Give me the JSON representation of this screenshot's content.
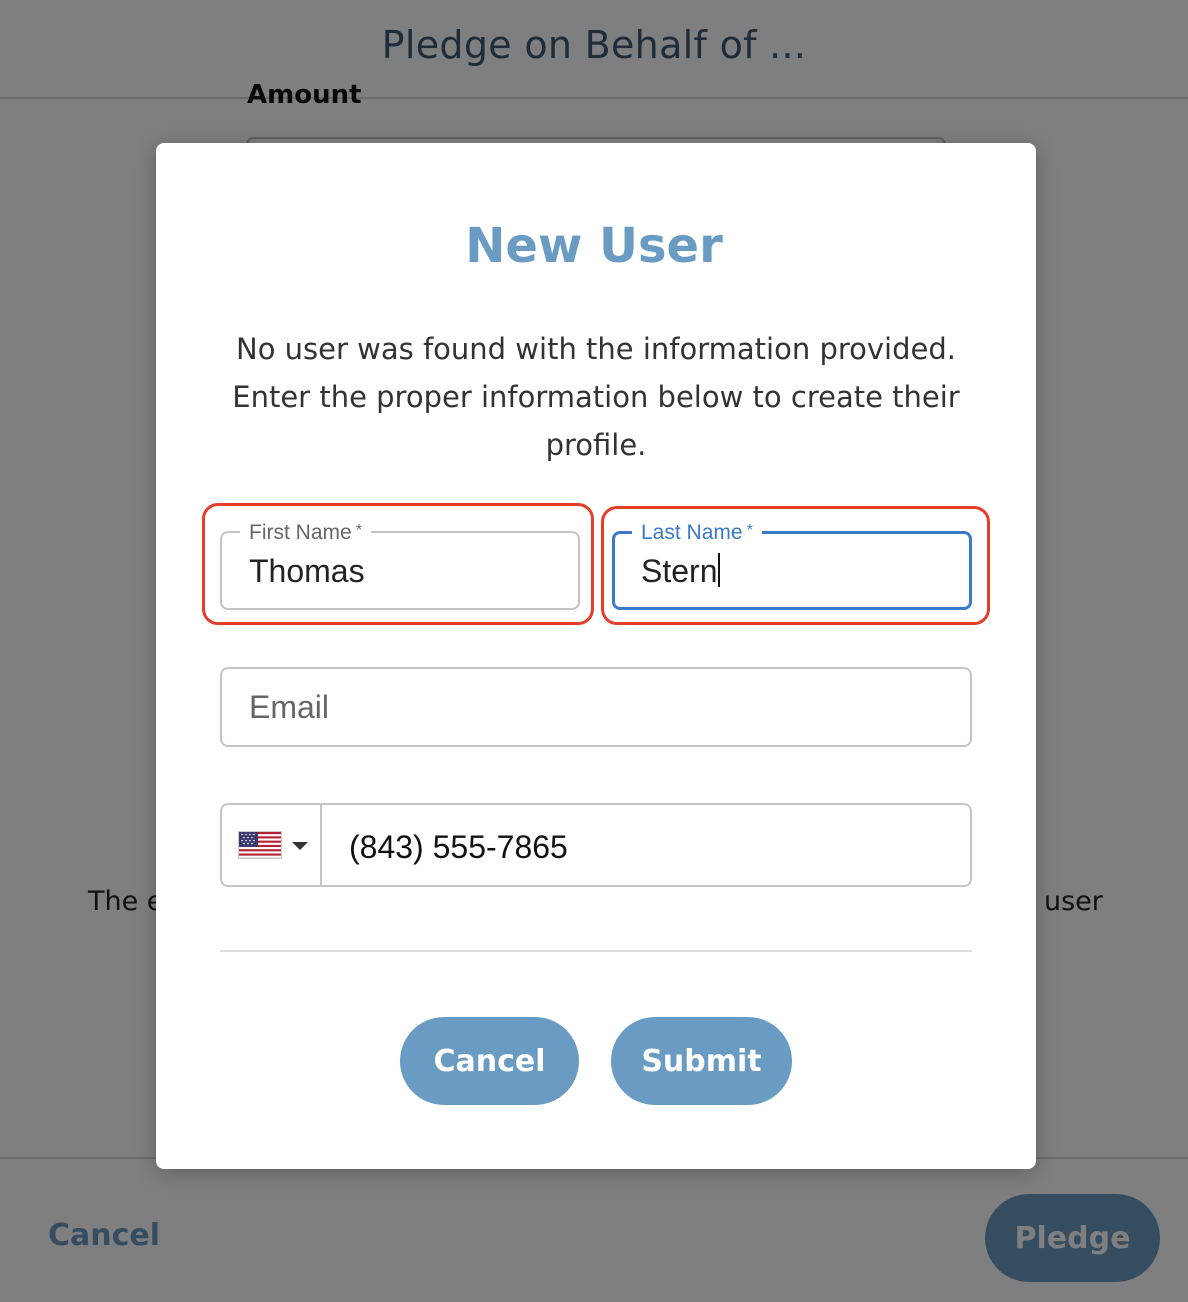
{
  "page": {
    "title": "Pledge on Behalf of ...",
    "amount_label": "Amount",
    "info_text_left": "The e",
    "info_text_right": "user",
    "footer": {
      "cancel_label": "Cancel",
      "pledge_label": "Pledge"
    }
  },
  "modal": {
    "title": "New User",
    "message": "No user was found with the information provided. Enter the proper information below to create their profile.",
    "first_name": {
      "label": "First Name",
      "required_mark": "*",
      "value": "Thomas"
    },
    "last_name": {
      "label": "Last Name",
      "required_mark": "*",
      "value": "Stern"
    },
    "email": {
      "placeholder": "Email",
      "value": ""
    },
    "phone": {
      "country_icon": "us-flag-icon",
      "value": "(843) 555-7865"
    },
    "buttons": {
      "cancel_label": "Cancel",
      "submit_label": "Submit"
    }
  },
  "colors": {
    "accent": "#6a9bc3",
    "title_dark": "#3d5a78",
    "focus_blue": "#3b79c9",
    "highlight_red": "#e53d2a"
  }
}
